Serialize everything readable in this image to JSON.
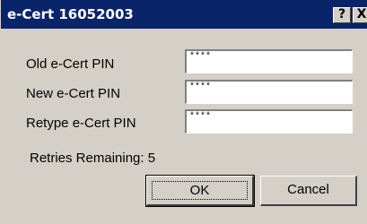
{
  "window": {
    "title": "e-Cert 16052003",
    "help_glyph": "?",
    "close_glyph": "X"
  },
  "form": {
    "old_pin_label": "Old e-Cert PIN",
    "old_pin_value": "****",
    "new_pin_label": "New e-Cert PIN",
    "new_pin_value": "****",
    "retype_pin_label": "Retype e-Cert PIN",
    "retype_pin_value": "****",
    "retries_text": "Retries Remaining: 5"
  },
  "buttons": {
    "ok_label": "OK",
    "cancel_label": "Cancel"
  },
  "colors": {
    "titlebar": "#0a246a",
    "dialog_face": "#d4d0c8"
  }
}
